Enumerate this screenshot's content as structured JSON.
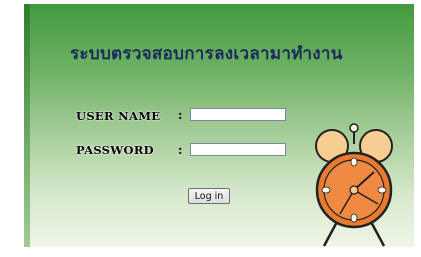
{
  "title": "ระบบตรวจสอบการลงเวลามาทำงาน",
  "form": {
    "username_label": "USER NAME",
    "password_label": "PASSWORD",
    "separator": ":",
    "username_value": "",
    "password_value": "",
    "login_button": "Log in"
  },
  "icons": {
    "illustration": "alarm-clock-icon"
  },
  "colors": {
    "panel_top": "#449a3e",
    "panel_bottom": "#eef6e8",
    "clock_face": "#e97a2f",
    "clock_bells": "#f7ce92"
  }
}
